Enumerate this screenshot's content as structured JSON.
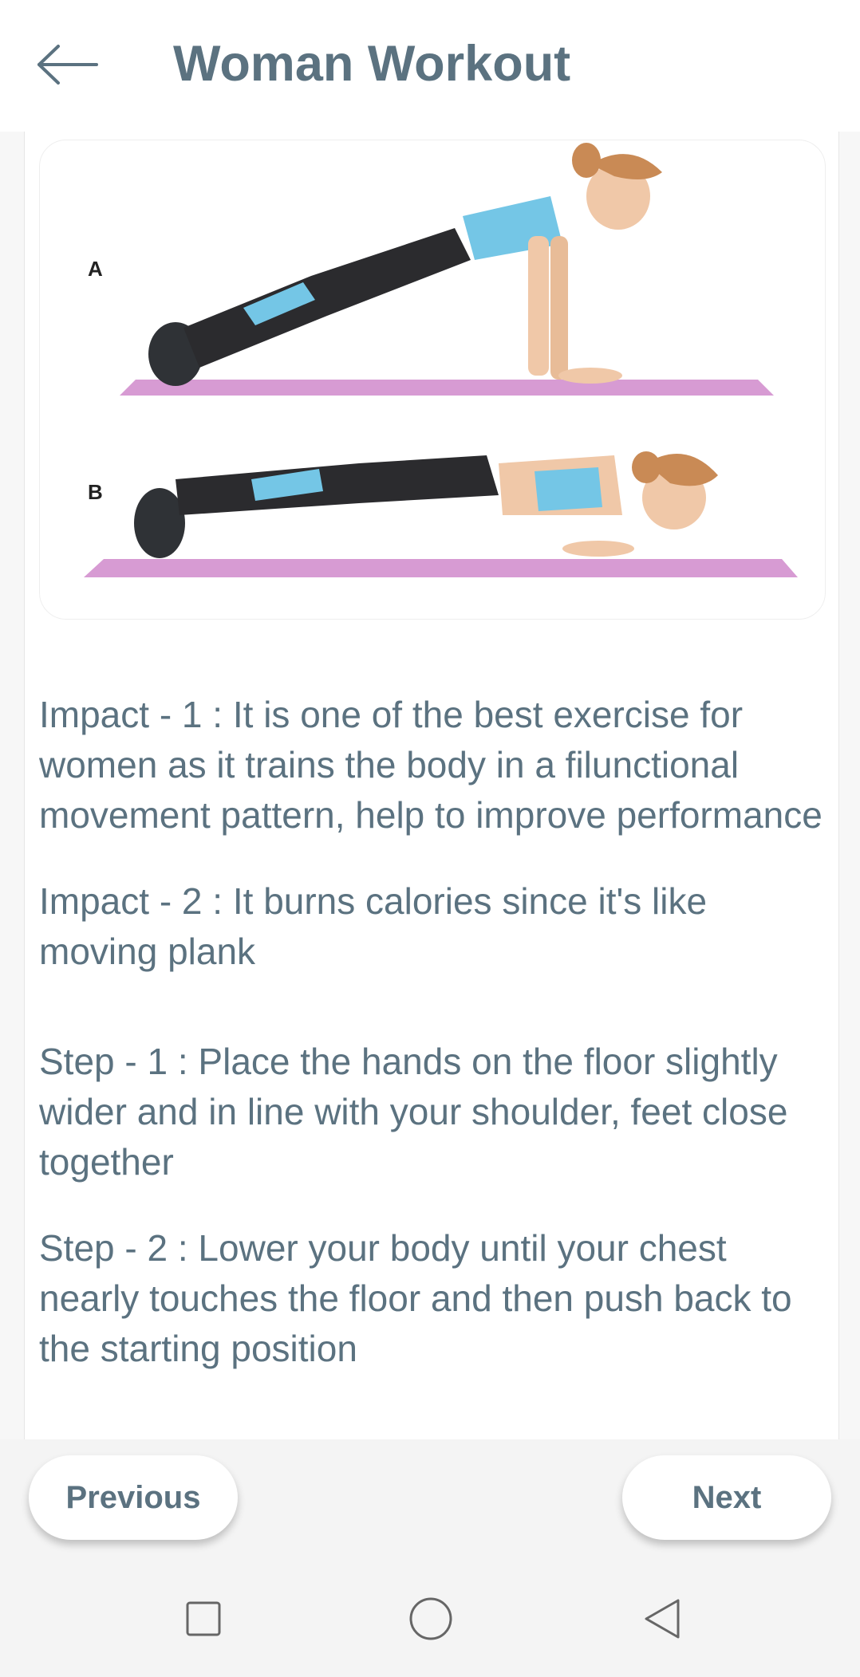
{
  "header": {
    "title": "Woman Workout",
    "back_icon": "arrow-left-icon"
  },
  "illustration": {
    "label_a": "A",
    "label_b": "B",
    "colors": {
      "mat": "#d79bd3",
      "top": "#74c6e6",
      "leggings": "#2b2b2e",
      "skin": "#f0c8a8",
      "hair": "#c98a55"
    }
  },
  "content": {
    "paragraphs": [
      "Impact - 1 :  It is one of the best exercise for women as it trains the body in a filunctional movement pattern, help to improve performance",
      "Impact - 2 :  It burns calories since it's like moving plank",
      "Step - 1 :  Place the hands on the floor slightly wider and in line with your shoulder, feet close together",
      "Step - 2 :  Lower your body until your chest nearly touches the floor and then push back to the starting position"
    ]
  },
  "footer": {
    "previous_label": "Previous",
    "next_label": "Next"
  },
  "system_nav": {
    "recents_icon": "square-icon",
    "home_icon": "circle-icon",
    "back_icon": "triangle-back-icon"
  }
}
